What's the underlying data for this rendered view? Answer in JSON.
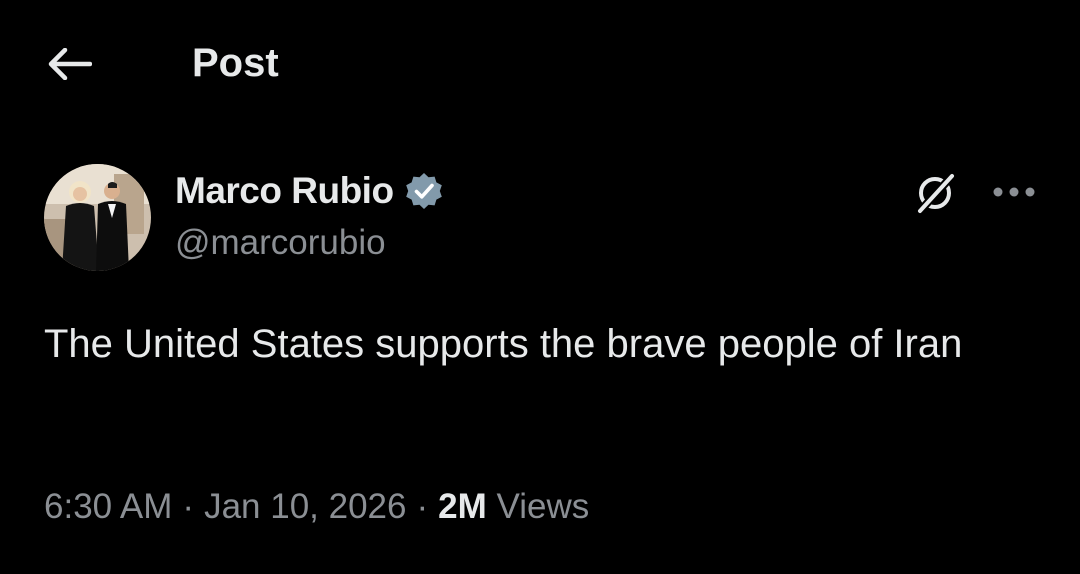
{
  "header": {
    "title": "Post",
    "back_icon": "arrow-left-icon"
  },
  "author": {
    "display_name": "Marco Rubio",
    "handle": "@marcorubio",
    "verified_color": "#829aab",
    "verified_icon": "verified-badge-icon"
  },
  "actions": {
    "grok_icon": "grok-icon",
    "more_icon": "more-horizontal-icon"
  },
  "post": {
    "text": "The United States supports the brave people of Iran"
  },
  "meta": {
    "time": "6:30 AM",
    "date": "Jan 10, 2026",
    "separator": "·",
    "views_count": "2M",
    "views_label": "Views"
  },
  "colors": {
    "background": "#000000",
    "primary_text": "#e7e9ea",
    "secondary_text": "#8b8f94"
  }
}
